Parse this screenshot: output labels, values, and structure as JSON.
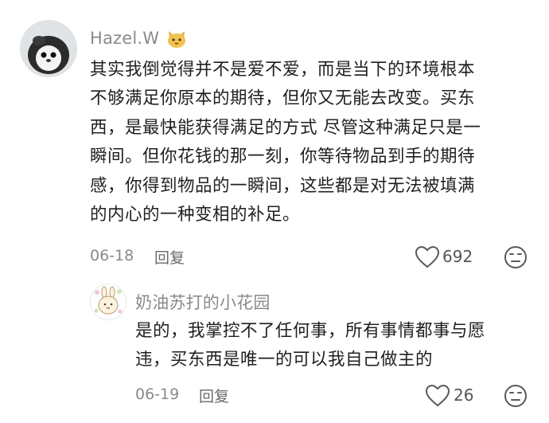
{
  "comment": {
    "username": "Hazel.W",
    "badge_icon": "cat-face-icon",
    "text": "其实我倒觉得并不是爱不爱，而是当下的环境根本\n不够满足你原本的期待，但你又无能去改变。买东\n西，是最快能获得满足的方式 尽管这种满足只是一\n瞬间。但你花钱的那一刻，你等待物品到手的期待\n感，你得到物品的一瞬间，这些都是对无法被填满\n的内心的一种变相的补足。",
    "date": "06-18",
    "reply_label": "回复",
    "like_count": "692"
  },
  "reply": {
    "username": "奶油苏打的小花园",
    "text": "是的，我掌控不了任何事，所有事情都事与愿\n违，买东西是唯一的可以我自己做主的",
    "date": "06-19",
    "reply_label": "回复",
    "like_count": "26"
  }
}
